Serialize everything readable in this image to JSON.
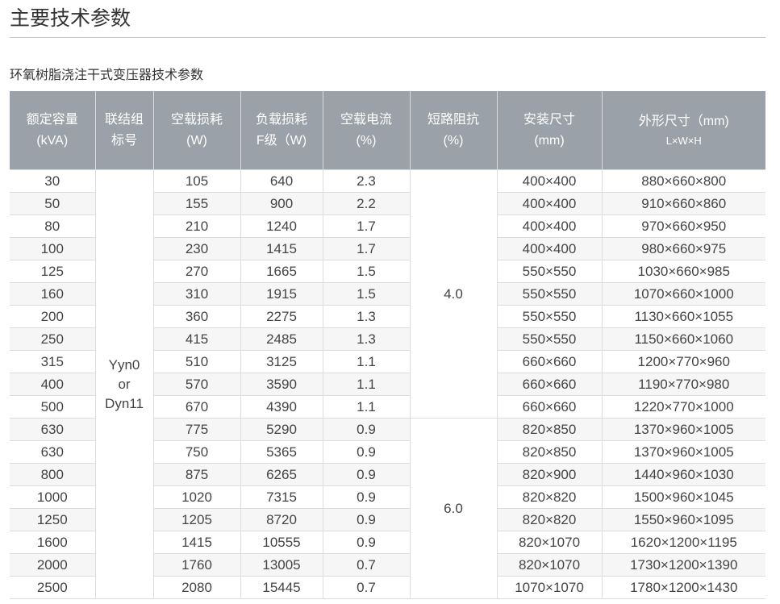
{
  "page_title": "主要技术参数",
  "table_title": "环氧树脂浇注干式变压器技术参数",
  "headers": [
    {
      "line1": "额定容量",
      "line2": "(kVA)"
    },
    {
      "line1": "联结组",
      "line2": "标号"
    },
    {
      "line1": "空载损耗",
      "line2": "(W)"
    },
    {
      "line1": "负载损耗",
      "line2": "F级（W)"
    },
    {
      "line1": "空载电流",
      "line2": "(%)"
    },
    {
      "line1": "短路阻抗",
      "line2": "(%)"
    },
    {
      "line1": "安装尺寸",
      "line2": "(mm)"
    },
    {
      "line1": "外形尺寸（mm)",
      "line2": "L×W×H"
    }
  ],
  "connection_group": {
    "line1": "Yyn0",
    "line2": "or",
    "line3": "Dyn11"
  },
  "impedance_groups": [
    {
      "value": "4.0",
      "rows": 11
    },
    {
      "value": "6.0",
      "rows": 8
    }
  ],
  "rows": [
    {
      "capacity": "30",
      "no_load_loss": "105",
      "load_loss": "640",
      "no_load_current": "2.3",
      "install_size": "400×400",
      "outline_size": "880×660×800"
    },
    {
      "capacity": "50",
      "no_load_loss": "155",
      "load_loss": "900",
      "no_load_current": "2.2",
      "install_size": "400×400",
      "outline_size": "910×660×860"
    },
    {
      "capacity": "80",
      "no_load_loss": "210",
      "load_loss": "1240",
      "no_load_current": "1.7",
      "install_size": "400×400",
      "outline_size": "970×660×950"
    },
    {
      "capacity": "100",
      "no_load_loss": "230",
      "load_loss": "1415",
      "no_load_current": "1.7",
      "install_size": "400×400",
      "outline_size": "980×660×975"
    },
    {
      "capacity": "125",
      "no_load_loss": "270",
      "load_loss": "1665",
      "no_load_current": "1.5",
      "install_size": "550×550",
      "outline_size": "1030×660×985"
    },
    {
      "capacity": "160",
      "no_load_loss": "310",
      "load_loss": "1915",
      "no_load_current": "1.5",
      "install_size": "550×550",
      "outline_size": "1070×660×1000"
    },
    {
      "capacity": "200",
      "no_load_loss": "360",
      "load_loss": "2275",
      "no_load_current": "1.3",
      "install_size": "550×550",
      "outline_size": "1130×660×1055"
    },
    {
      "capacity": "250",
      "no_load_loss": "415",
      "load_loss": "2485",
      "no_load_current": "1.3",
      "install_size": "550×550",
      "outline_size": "1150×660×1060"
    },
    {
      "capacity": "315",
      "no_load_loss": "510",
      "load_loss": "3125",
      "no_load_current": "1.1",
      "install_size": "660×660",
      "outline_size": "1200×770×960"
    },
    {
      "capacity": "400",
      "no_load_loss": "570",
      "load_loss": "3590",
      "no_load_current": "1.1",
      "install_size": "660×660",
      "outline_size": "1190×770×980"
    },
    {
      "capacity": "500",
      "no_load_loss": "670",
      "load_loss": "4390",
      "no_load_current": "1.1",
      "install_size": "660×660",
      "outline_size": "1220×770×1000"
    },
    {
      "capacity": "630",
      "no_load_loss": "775",
      "load_loss": "5290",
      "no_load_current": "0.9",
      "install_size": "820×850",
      "outline_size": "1370×960×1005"
    },
    {
      "capacity": "630",
      "no_load_loss": "750",
      "load_loss": "5365",
      "no_load_current": "0.9",
      "install_size": "820×850",
      "outline_size": "1370×960×1005"
    },
    {
      "capacity": "800",
      "no_load_loss": "875",
      "load_loss": "6265",
      "no_load_current": "0.9",
      "install_size": "820×900",
      "outline_size": "1440×960×1030"
    },
    {
      "capacity": "1000",
      "no_load_loss": "1020",
      "load_loss": "7315",
      "no_load_current": "0.9",
      "install_size": "820×820",
      "outline_size": "1500×960×1045"
    },
    {
      "capacity": "1250",
      "no_load_loss": "1205",
      "load_loss": "8720",
      "no_load_current": "0.9",
      "install_size": "820×820",
      "outline_size": "1550×960×1095"
    },
    {
      "capacity": "1600",
      "no_load_loss": "1415",
      "load_loss": "10555",
      "no_load_current": "0.9",
      "install_size": "820×1070",
      "outline_size": "1620×1200×1195"
    },
    {
      "capacity": "2000",
      "no_load_loss": "1760",
      "load_loss": "13005",
      "no_load_current": "0.7",
      "install_size": "820×1070",
      "outline_size": "1730×1200×1390"
    },
    {
      "capacity": "2500",
      "no_load_loss": "2080",
      "load_loss": "15445",
      "no_load_current": "0.7",
      "install_size": "1070×1070",
      "outline_size": "1780×1200×1430"
    }
  ],
  "colors": {
    "header_bg": "#9aa1a8",
    "header_text": "#ffffff",
    "stripe_bg": "#f6f6f6",
    "rule": "#c8c8c8"
  }
}
